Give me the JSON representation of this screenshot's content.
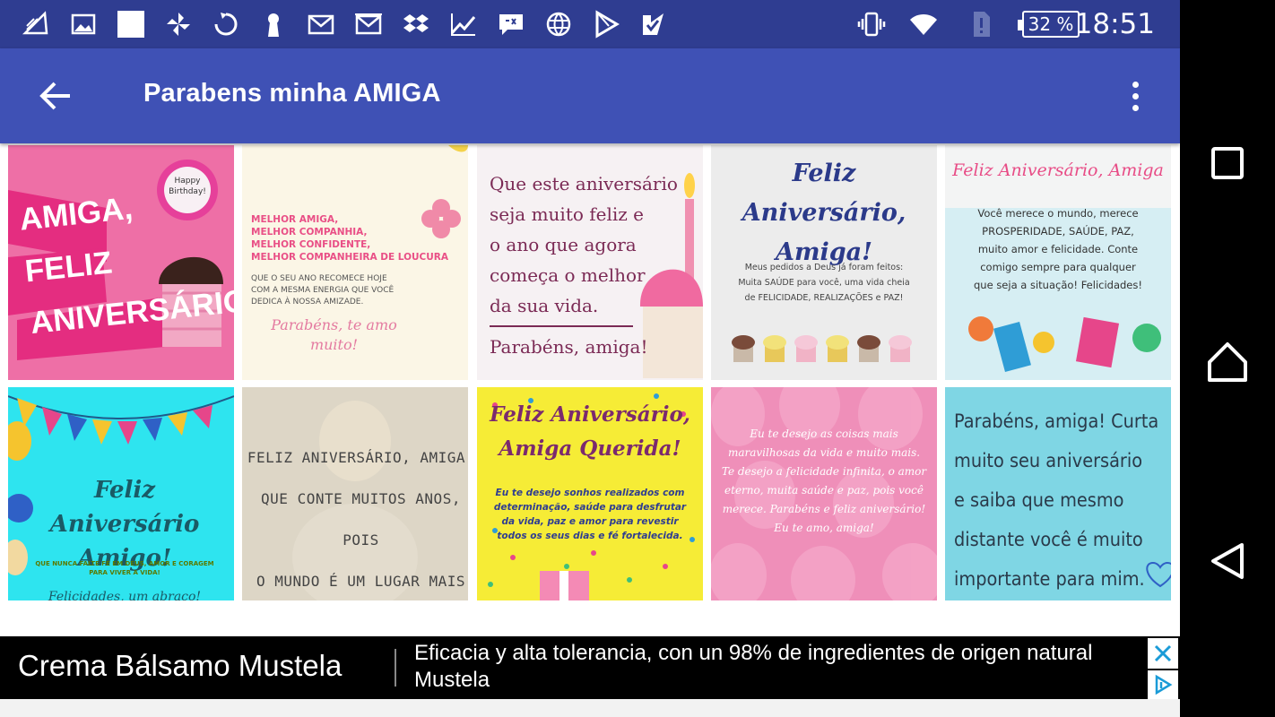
{
  "status_bar": {
    "time": "18:51",
    "battery": "32 %",
    "notification_icons": [
      "gallery-icon",
      "image-icon",
      "blank-square-icon",
      "pinwheel-icon",
      "sync-icon",
      "keyhole-icon",
      "gmail-icon",
      "gmail-icon",
      "dropbox-icon",
      "trending-icon",
      "message-icon",
      "globe-icon",
      "play-store-icon",
      "check-icon"
    ],
    "system_icons": [
      "vibrate-icon",
      "wifi-icon",
      "no-sim-icon",
      "battery-icon"
    ]
  },
  "app_bar": {
    "title": "Parabens minha AMIGA",
    "back_icon": "arrow-left-icon",
    "menu_icon": "more-vert-icon"
  },
  "cards": [
    {
      "text": "AMIGA,\nFELIZ\nANIVERSÁRIO",
      "badge": "Happy\nBirthday!",
      "bg": "#ee6fa6"
    },
    {
      "text": "MELHOR AMIGA,\nMELHOR COMPANHIA,\nMELHOR CONFIDENTE,\nMELHOR COMPANHEIRA DE LOUCURA",
      "sub": "QUE O SEU ANO RECOMECE HOJE\nCOM A MESMA ENERGIA QUE VOCÊ\nDEDICA À NOSSA AMIZADE.",
      "sign": "Parabéns, te amo\nmuito!",
      "bg": "#fbf6e6"
    },
    {
      "text": "Que este aniversário\nseja muito feliz e\no ano que agora\ncomeça o melhor\nda sua vida.",
      "sign": "Parabéns, amiga!",
      "bg": "#f6f1f3"
    },
    {
      "text": "Feliz Aniversário,\nAmiga!",
      "sub": "Meus pedidos a Deus já foram feitos:\nMuita SAÚDE para você, uma vida cheia\nde FELICIDADE, REALIZAÇÕES e PAZ!",
      "bg": "#ececec"
    },
    {
      "text": "Feliz Aniversário, Amiga",
      "sub": "Você merece o mundo, merece\nPROSPERIDADE, SAÚDE, PAZ,\nmuito amor e felicidade. Conte\ncomigo sempre para qualquer\nque seja a situação!  Felicidades!",
      "bg": "#d6eef3"
    },
    {
      "text": "Feliz Aniversário\nAmigo!",
      "sub": "QUE NUNCA FALTE FÉ EM DEUS, AMOR E CORAGEM\nPARA VIVER A VIDA!",
      "sign": "Felicidades, um abraço!",
      "bg": "#2ee4ef"
    },
    {
      "text": "FELIZ ANIVERSÁRIO, AMIGA!\nQUE CONTE MUITOS ANOS, POIS\nO MUNDO É UM LUGAR MAIS\nBELO POR TER VOCÊ NELE.",
      "bg": "#ddd6c6"
    },
    {
      "text": "Feliz Aniversário,\nAmiga Querida!",
      "sub": "Eu te desejo sonhos realizados com\ndeterminação, saúde para desfrutar\nda vida, paz e amor para revestir\ntodos os seus dias e fé fortalecida.",
      "bg": "#f6ec36"
    },
    {
      "text": "Eu te desejo as coisas mais\nmaravilhosas da vida e muito mais.\nTe desejo a felicidade infinita, o amor\neterno, muita saúde e paz, pois você\nmerece. Parabéns e feliz aniversário!\nEu te amo, amiga!",
      "bg": "#ef8fb9"
    },
    {
      "text": "Parabéns, amiga! Curta\nmuito seu aniversário\ne saiba que mesmo\ndistante você é muito\nimportante para mim.",
      "bg": "#7fd6e4"
    }
  ],
  "ad": {
    "title": "Crema Bálsamo Mustela",
    "text": "Eficacia y alta tolerancia, con un 98% de ingredientes de origen natural Mustela",
    "close_icon": "close-icon",
    "info_icon": "adchoices-icon"
  },
  "nav_bar": {
    "buttons": [
      "recents-square-icon",
      "home-icon",
      "back-triangle-icon"
    ]
  }
}
